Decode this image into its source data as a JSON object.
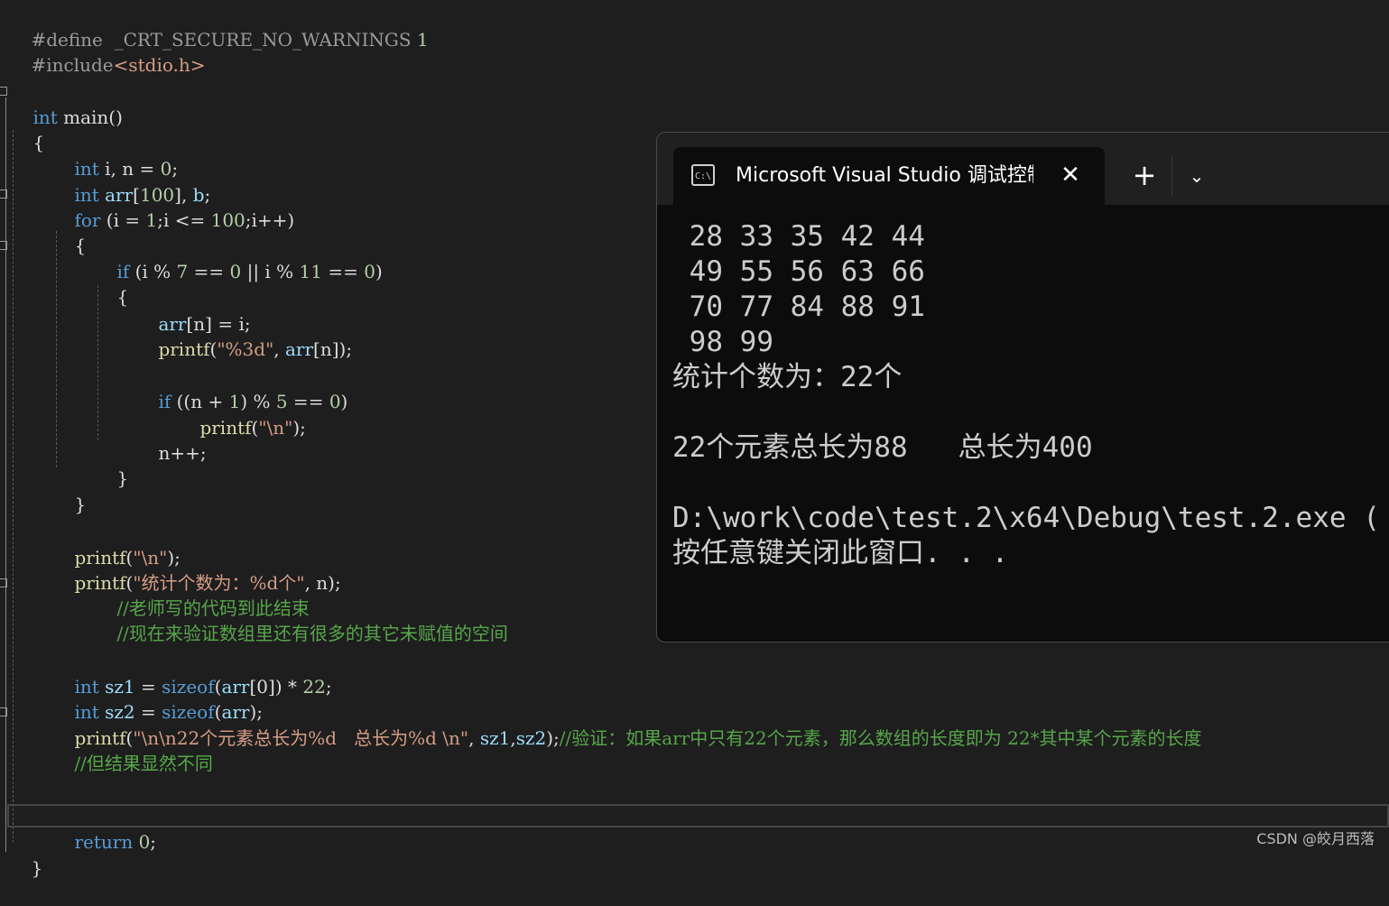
{
  "editor": {
    "lines": {
      "l1": {
        "pp": "#define",
        "name": "  _CRT_SECURE_NO_WARNINGS",
        "num": " 1"
      },
      "l2": {
        "pp": "#include",
        "header": "<stdio.h>"
      },
      "l4": {
        "kw": "int",
        "rest": " main()"
      },
      "l5": {
        "text": "{"
      },
      "l6": {
        "kw": "int",
        "rest": " i, n = ",
        "num": "0",
        "end": ";"
      },
      "l7": {
        "kw": "int",
        "var": " arr",
        "b1": "[",
        "num": "100",
        "b2": "], ",
        "var2": "b",
        "end": ";"
      },
      "l8": {
        "kw": "for",
        "rest": " (i = ",
        "num1": "1",
        "mid": ";i <= ",
        "num2": "100",
        "end": ";i++)"
      },
      "l9": {
        "text": "{"
      },
      "l10": {
        "kw": "if",
        "rest": " (i % ",
        "num1": "7",
        "mid": " == ",
        "num2": "0",
        "mid2": " || i % ",
        "num3": "11",
        "mid3": " == ",
        "num4": "0",
        "end": ")"
      },
      "l11": {
        "text": "{"
      },
      "l12": {
        "var": "arr",
        "rest": "[n] = i;"
      },
      "l13": {
        "fn": "printf",
        "open": "(",
        "str": "\"%3d\"",
        "mid": ", ",
        "var": "arr",
        "end": "[n]);"
      },
      "l15": {
        "kw": "if",
        "rest": " ((n + ",
        "num1": "1",
        "mid": ") % ",
        "num2": "5",
        "mid2": " == ",
        "num3": "0",
        "end": ")"
      },
      "l16": {
        "fn": "printf",
        "open": "(",
        "str": "\"\\n\"",
        "end": ");"
      },
      "l17": {
        "text": "n++;"
      },
      "l18": {
        "text": "}"
      },
      "l19": {
        "text": "}"
      },
      "l21": {
        "fn": "printf",
        "open": "(",
        "str": "\"\\n\"",
        "end": ");"
      },
      "l22": {
        "fn": "printf",
        "open": "(",
        "str": "\"统计个数为：%d个\"",
        "end": ", n);"
      },
      "l23": {
        "comment": "//老师写的代码到此结束"
      },
      "l24": {
        "comment": "//现在来验证数组里还有很多的其它未赋值的空间"
      },
      "l26": {
        "kw": "int",
        "var": " sz1",
        "eq": " = ",
        "kw2": "sizeof",
        "open": "(",
        "var2": "arr",
        "idx": "[0]",
        "rest": ") * ",
        "num": "22",
        "end": ";"
      },
      "l27": {
        "kw": "int",
        "var": " sz2",
        "eq": " = ",
        "kw2": "sizeof",
        "open": "(",
        "var2": "arr",
        "end": ");"
      },
      "l28": {
        "fn": "printf",
        "open": "(",
        "str": "\"\\n\\n22个元素总长为%d   总长为%d \\n\"",
        "mid": ", ",
        "var": "sz1",
        "comma": ",",
        "var2": "sz2",
        "end": ");",
        "comment": "//验证：如果arr中只有22个元素，那么数组的长度即为 22*其中某个元素的长度"
      },
      "l29": {
        "comment": "//但结果显然不同"
      },
      "l32": {
        "kw": "return",
        "rest": " ",
        "num": "0",
        "end": ";"
      },
      "l33": {
        "text": "}"
      }
    }
  },
  "terminal": {
    "icon_label": "C:\\",
    "tab_title": "Microsoft Visual Studio 调试控制台",
    "close_glyph": "✕",
    "new_tab_glyph": "+",
    "dropdown_glyph": "⌄",
    "output": [
      " 28 33 35 42 44",
      " 49 55 56 63 66",
      " 70 77 84 88 91",
      " 98 99",
      "统计个数为：22个",
      "",
      "22个元素总长为88   总长为400",
      "",
      "D:\\work\\code\\test.2\\x64\\Debug\\test.2.exe (",
      "按任意键关闭此窗口. . ."
    ]
  },
  "watermark": "CSDN @皎月西落"
}
